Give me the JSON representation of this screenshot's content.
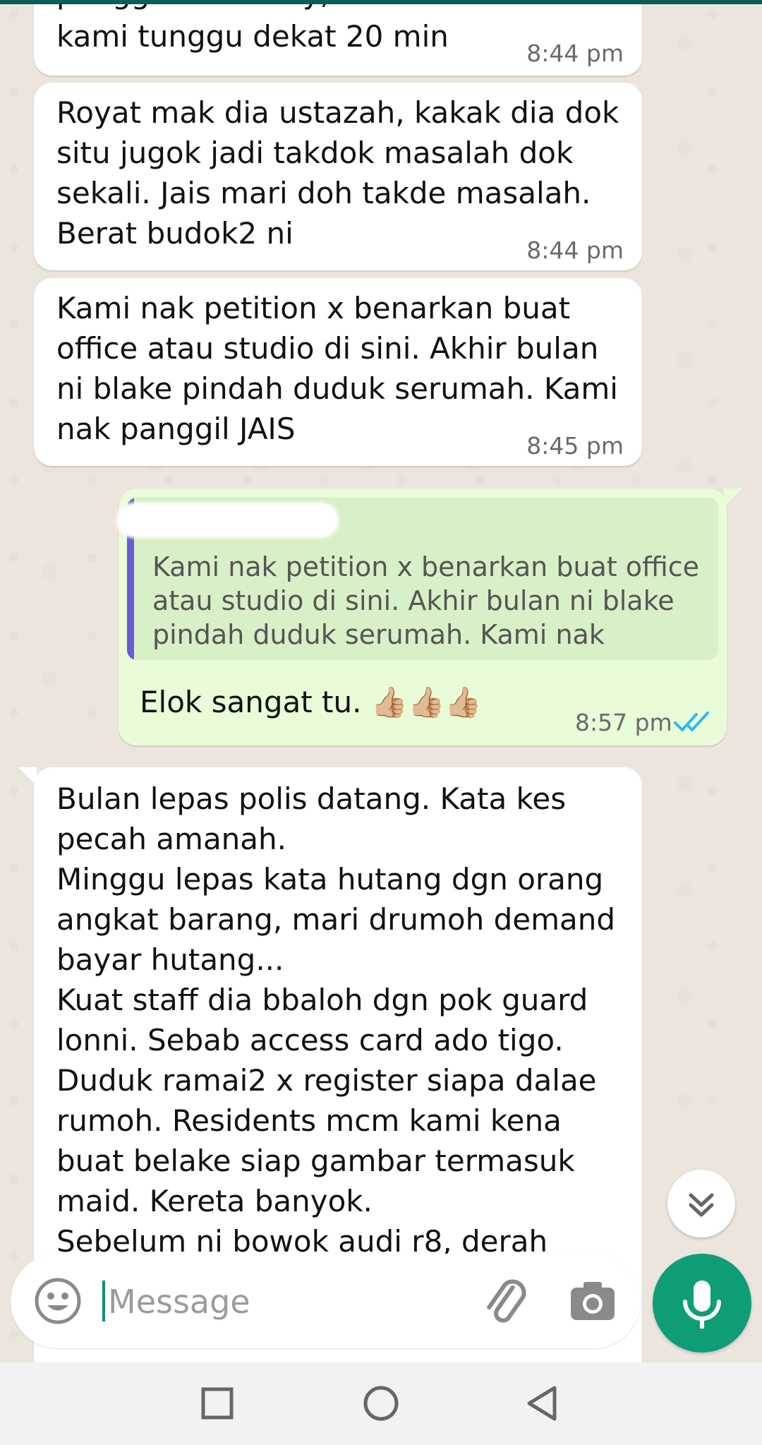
{
  "colors": {
    "chat_background": "#ece5dd",
    "incoming_bubble": "#ffffff",
    "outgoing_bubble": "#e7fcd7",
    "quote_background": "#d8f0c8",
    "quote_bar": "#6b5bd8",
    "read_ticks": "#34b7f1",
    "mic_button": "#0f9d76",
    "top_bar": "#075e54"
  },
  "messages": [
    {
      "direction": "incoming",
      "partial_text": "panggil nak bloey, dia bulen buat",
      "text": "kami tunggu dekat 20 min",
      "time": "8:44 pm"
    },
    {
      "direction": "incoming",
      "text": "Royat mak dia ustazah, kakak dia dok\nsitu jugok jadi takdok masalah dok\nsekali. Jais mari doh takde masalah.\nBerat budok2 ni",
      "time": "8:44 pm"
    },
    {
      "direction": "incoming",
      "text": "Kami nak petition x benarkan buat\noffice atau studio di sini.  Akhir bulan\nni blake pindah duduk serumah. Kami\nnak panggil JAIS",
      "time": "8:45 pm"
    },
    {
      "direction": "outgoing",
      "quote_text": "Kami nak petition x benarkan buat office\natau studio di sini.  Akhir bulan ni blake\npindah duduk serumah. Kami nak pangg...",
      "text": "Elok sangat tu. 👍🏼👍🏼👍🏼",
      "time": "8:57 pm",
      "status_icon": "double-check-read-icon"
    },
    {
      "direction": "incoming",
      "text": "Bulan lepas polis datang. Kata kes\npecah amanah.\nMinggu lepas kata hutang dgn orang\nangkat barang, mari drumoh demand\nbayar hutang...\nKuat staff dia bbaloh dgn pok guard\nlonni.  Sebab access card ado tigo.\nDuduk ramai2 x register siapa dalae\nrumoh. Residents mcm kami kena\nbuat belake siap gambar termasuk\nmaid.  Kereta banyok.\nSebelum ni bowok audi r8, derah"
    }
  ],
  "composer": {
    "placeholder": "Message",
    "emoji_icon": "emoji-icon",
    "attach_icon": "paperclip-icon",
    "camera_icon": "camera-icon",
    "mic_icon": "microphone-icon"
  },
  "scroll_button_icon": "double-chevron-down-icon",
  "navbar": {
    "recents_icon": "square-icon",
    "home_icon": "circle-icon",
    "back_icon": "triangle-back-icon"
  }
}
